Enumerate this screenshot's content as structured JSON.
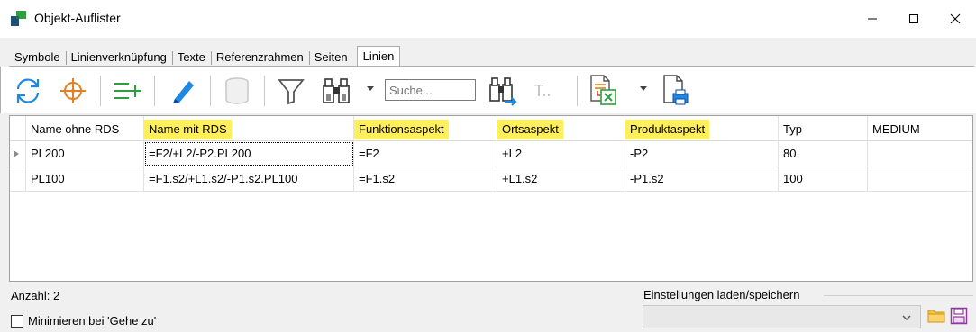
{
  "window": {
    "title": "Objekt-Auflister",
    "minimize_glyph": "—",
    "maximize_glyph": "☐",
    "close_glyph": "✕"
  },
  "tabs": [
    {
      "label": "Symbole",
      "active": false
    },
    {
      "label": "Linienverknüpfung",
      "active": false
    },
    {
      "label": "Texte",
      "active": false
    },
    {
      "label": "Referenzrahmen",
      "active": false
    },
    {
      "label": "Seiten",
      "active": false
    },
    {
      "label": "Linien",
      "active": true
    }
  ],
  "toolbar": {
    "search_placeholder": "Suche...",
    "disabled_text_glyph": "T..",
    "icons": [
      "refresh-icon",
      "crosshair-icon",
      "add-lines-icon",
      "pencil-icon",
      "database-icon",
      "filter-icon",
      "binoculars-icon",
      "find-replace-icon",
      "text-icon",
      "excel-export-icon",
      "print-icon"
    ]
  },
  "grid": {
    "columns": [
      {
        "label": "Name ohne RDS",
        "highlight": false
      },
      {
        "label": "Name mit RDS",
        "highlight": true
      },
      {
        "label": "Funktionsaspekt",
        "highlight": true
      },
      {
        "label": "Ortsaspekt",
        "highlight": true
      },
      {
        "label": "Produktaspekt",
        "highlight": true
      },
      {
        "label": "Typ",
        "highlight": false
      },
      {
        "label": "MEDIUM",
        "highlight": false
      }
    ],
    "rows": [
      [
        "PL200",
        "=F2/+L2/-P2.PL200",
        "=F2",
        "+L2",
        "-P2",
        "80",
        ""
      ],
      [
        "PL100",
        "=F1.s2/+L1.s2/-P1.s2.PL100",
        "=F1.s2",
        "+L1.s2",
        "-P1.s2",
        "100",
        ""
      ]
    ]
  },
  "footer": {
    "count_label": "Anzahl: 2",
    "minimize_label": "Minimieren bei 'Gehe zu'",
    "settings_label": "Einstellungen laden/speichern"
  },
  "colors": {
    "highlight": "#ffef5a",
    "accent_blue": "#1e88e5",
    "accent_green": "#2e9e3e",
    "accent_orange": "#e67e22"
  }
}
